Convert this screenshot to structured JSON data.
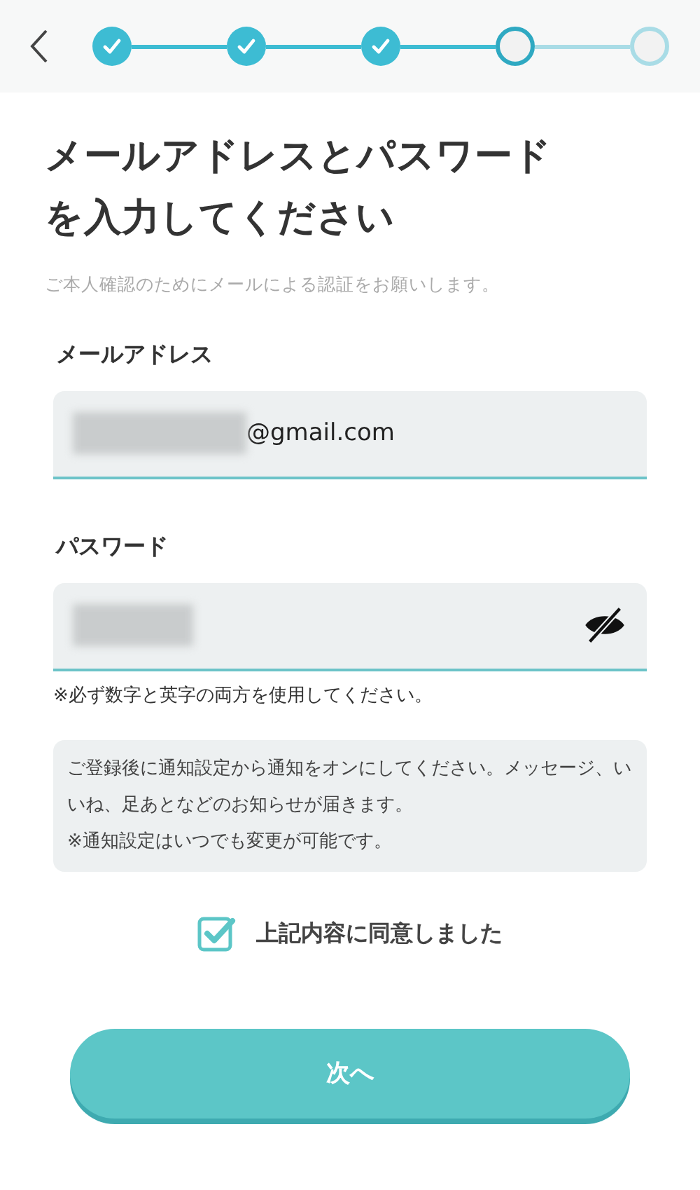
{
  "steps": [
    {
      "completed": true,
      "selected": false
    },
    {
      "completed": true,
      "selected": false
    },
    {
      "completed": true,
      "selected": false
    },
    {
      "completed": false,
      "selected": true
    },
    {
      "completed": false,
      "selected": false
    }
  ],
  "title": "メールアドレスとパスワードを入力してください",
  "subtitle": "ご本人確認のためにメールによる認証をお願いします。",
  "email": {
    "label": "メールアドレス",
    "value": "@gmail.com"
  },
  "password": {
    "label": "パスワード",
    "hint": "※必ず数字と英字の両方を使用してください。"
  },
  "notice": [
    "ご登録後に通知設定から通知をオンにしてください。メッセージ、いいね、足あとなどのお知らせが届きます。",
    "※通知設定はいつでも変更が可能です。"
  ],
  "agree": {
    "label": "上記内容に同意しました",
    "checked": true
  },
  "next_button": "次へ"
}
